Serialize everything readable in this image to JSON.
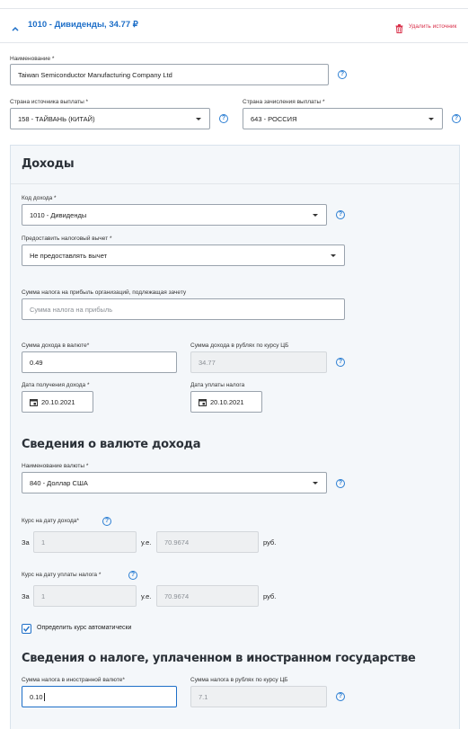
{
  "header": {
    "title": "1010 - Дивиденды, 34.77 ₽",
    "delete_label": "Удалить источник",
    "accent_color": "#1e6fc8",
    "danger_color": "#d9304a"
  },
  "source": {
    "name_label": "Наименование *",
    "name_value": "Taiwan Semiconductor Manufacturing Company Ltd",
    "country_label": "Страна источника выплаты *",
    "country_value": "158 - ТАЙВАНЬ (КИТАЙ)",
    "credit_country_label": "Страна зачисления выплаты *",
    "credit_country_value": "643 - РОССИЯ"
  },
  "income": {
    "section_title": "Доходы",
    "code_label": "Код дохода *",
    "code_value": "1010 - Дивиденды",
    "deduction_label": "Предоставить налоговый вычет *",
    "deduction_value": "Не предоставлять вычет",
    "profit_tax_label": "Сумма налога на прибыль организаций, подлежащая зачету",
    "profit_tax_placeholder": "Сумма налога на прибыль",
    "amount_cur_label": "Сумма дохода в валюте*",
    "amount_cur_value": "0.49",
    "amount_rub_label": "Сумма дохода в рублях по курсу ЦБ",
    "amount_rub_value": "34.77",
    "date_income_label": "Дата получения дохода *",
    "date_income_value": "20.10.2021",
    "date_tax_label": "Дата уплаты налога",
    "date_tax_value": "20.10.2021"
  },
  "currency": {
    "section_title": "Сведения о валюте дохода",
    "name_label": "Наименование валюты *",
    "name_value": "840 - Доллар США",
    "rate_income_label": "Курс на дату дохода*",
    "rate_tax_label": "Курс на дату уплаты налога *",
    "za": "За",
    "ue": "у.е.",
    "rub": "руб.",
    "rate_income_units": "1",
    "rate_income_value": "70.9674",
    "rate_tax_units": "1",
    "rate_tax_value": "70.9674",
    "auto_label": "Определить курс автоматически",
    "auto_checked": true
  },
  "foreign_tax": {
    "section_title": "Сведения о налоге, уплаченном в иностранном государстве",
    "cur_label": "Сумма налога в иностранной валюте*",
    "cur_value": "0.10",
    "rub_label": "Сумма налога в рублях по курсу ЦБ",
    "rub_value": "7.1"
  },
  "icons": {
    "collapse": "chevron-up-icon",
    "delete": "trash-icon",
    "help": "question-circle-icon",
    "calendar": "calendar-icon",
    "checkbox": "checkbox-checked-icon"
  },
  "help_glyph": "?"
}
